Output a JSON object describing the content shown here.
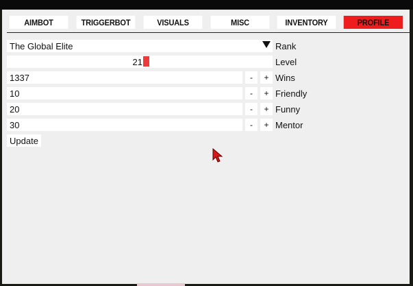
{
  "tabs": [
    {
      "label": "AIMBOT",
      "active": false
    },
    {
      "label": "TRIGGERBOT",
      "active": false
    },
    {
      "label": "VISUALS",
      "active": false
    },
    {
      "label": "MISC",
      "active": false
    },
    {
      "label": "INVENTORY",
      "active": false
    },
    {
      "label": "PROFILE",
      "active": true
    }
  ],
  "profile": {
    "rank": {
      "value": "The Global Elite",
      "label": "Rank"
    },
    "level": {
      "value": "21",
      "label": "Level"
    },
    "wins": {
      "value": "1337",
      "label": "Wins"
    },
    "friendly": {
      "value": "10",
      "label": "Friendly"
    },
    "funny": {
      "value": "20",
      "label": "Funny"
    },
    "mentor": {
      "value": "30",
      "label": "Mentor"
    },
    "stepper": {
      "minus": "-",
      "plus": "+"
    },
    "update_label": "Update"
  },
  "colors": {
    "accent": "#ee1c1c",
    "panel": "#efefef",
    "field": "#ffffff",
    "frame": "#1a1a14"
  },
  "icons": {
    "dropdown": "caret-down-icon",
    "cursor": "mouse-cursor-icon"
  }
}
